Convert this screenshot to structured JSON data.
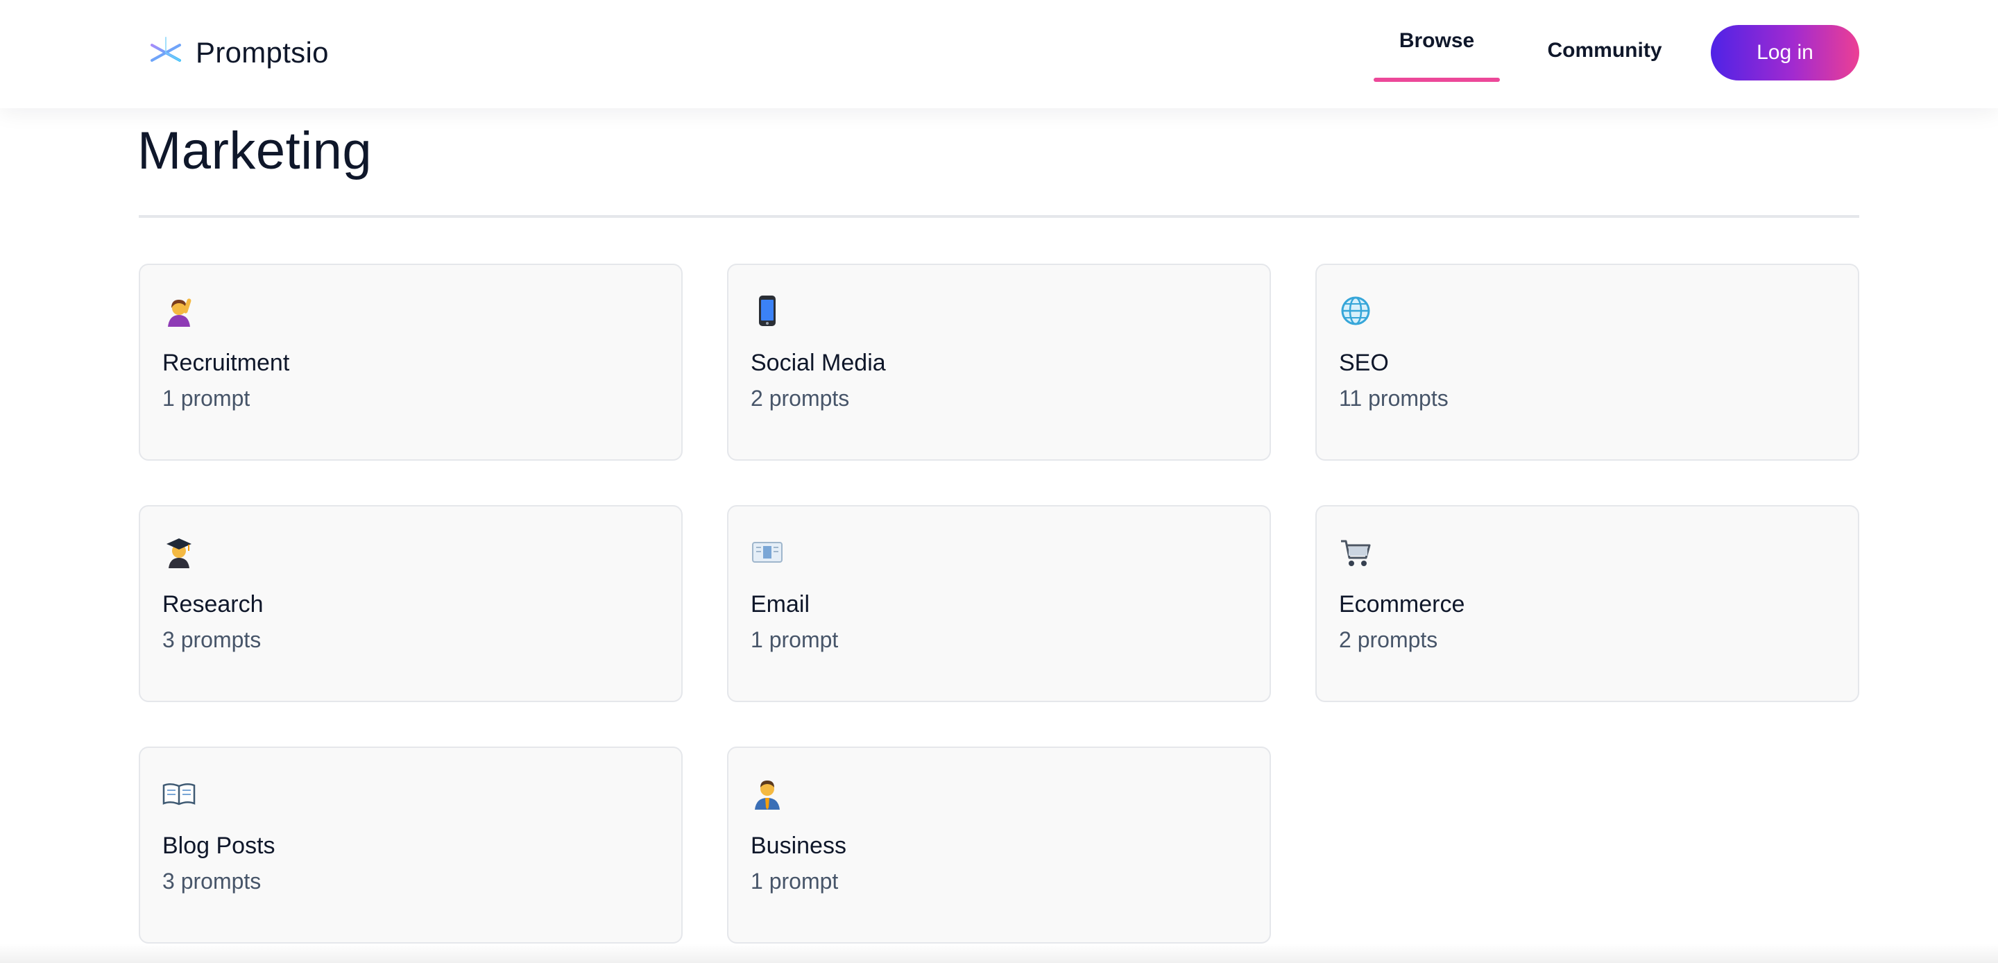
{
  "header": {
    "brand": "Promptsio",
    "logo_icon": "asterisk-logo-icon",
    "nav": [
      {
        "label": "Browse",
        "active": true
      },
      {
        "label": "Community",
        "active": false
      }
    ],
    "login_label": "Log in",
    "colors": {
      "active_underline": "#ec4899",
      "login_gradient_start": "#4f23e6",
      "login_gradient_end": "#ec3f94"
    }
  },
  "page": {
    "title": "Marketing"
  },
  "categories": [
    {
      "icon": "person-raising-hand-icon",
      "title": "Recruitment",
      "count": "1 prompt"
    },
    {
      "icon": "mobile-phone-icon",
      "title": "Social Media",
      "count": "2 prompts"
    },
    {
      "icon": "globe-icon",
      "title": "SEO",
      "count": "11 prompts"
    },
    {
      "icon": "student-graduation-cap-icon",
      "title": "Research",
      "count": "3 prompts"
    },
    {
      "icon": "newspaper-email-icon",
      "title": "Email",
      "count": "1 prompt"
    },
    {
      "icon": "shopping-cart-icon",
      "title": "Ecommerce",
      "count": "2 prompts"
    },
    {
      "icon": "open-book-icon",
      "title": "Blog Posts",
      "count": "3 prompts"
    },
    {
      "icon": "businessman-icon",
      "title": "Business",
      "count": "1 prompt"
    }
  ]
}
